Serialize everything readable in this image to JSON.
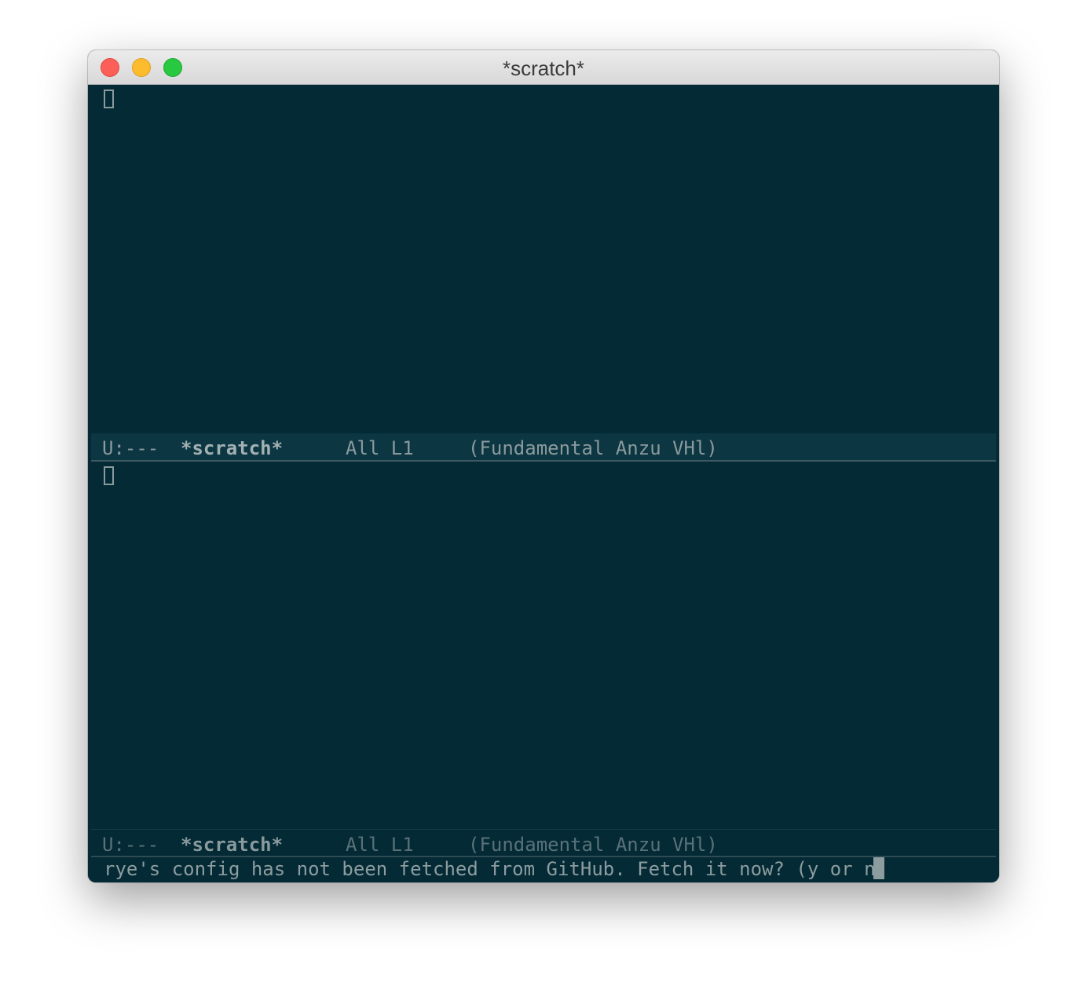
{
  "window": {
    "title": "*scratch*"
  },
  "panes": {
    "top": {
      "modeline": {
        "status": "U:---",
        "buffer": "*scratch*",
        "position": "All L1",
        "modes": "(Fundamental Anzu VHl)"
      }
    },
    "bottom": {
      "modeline": {
        "status": "U:---",
        "buffer": "*scratch*",
        "position": "All L1",
        "modes": "(Fundamental Anzu VHl)"
      }
    }
  },
  "minibuffer": {
    "prompt": "rye's config has not been fetched from GitHub. Fetch it now? (y or n)"
  },
  "colors": {
    "background": "#032a35",
    "modeline_active": "#0b3642",
    "text": "#8d9c9f"
  }
}
